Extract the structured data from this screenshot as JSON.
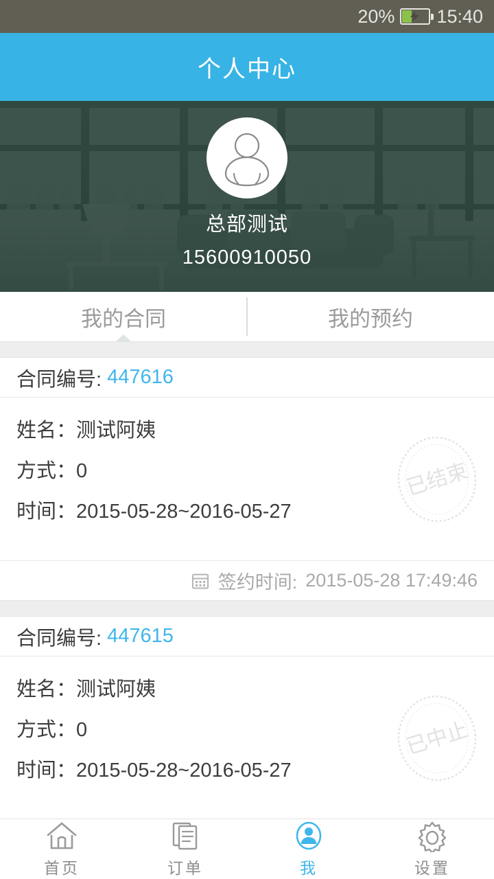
{
  "status_bar": {
    "battery_percent": "20%",
    "battery_icon": "battery-charging-icon",
    "time": "15:40",
    "background_color": "#615f54",
    "battery_fill_color": "#8bc34a"
  },
  "header": {
    "title": "个人中心",
    "background_color": "#38b3e5"
  },
  "profile": {
    "avatar_icon": "user-avatar-icon",
    "name": "总部测试",
    "phone": "15600910050"
  },
  "tabs": {
    "items": [
      {
        "label": "我的合同",
        "active": true
      },
      {
        "label": "我的预约",
        "active": false
      }
    ]
  },
  "contracts": [
    {
      "number_label": "合同编号:",
      "number_value": "447616",
      "name_label": "姓名：",
      "name_value": "测试阿姨",
      "method_label": "方式：",
      "method_value": "0",
      "time_label": "时间：",
      "time_value": "2015-05-28~2016-05-27",
      "stamp_text": "已结束",
      "sign_icon": "calendar-icon",
      "sign_label": "签约时间:",
      "sign_value": "2015-05-28 17:49:46"
    },
    {
      "number_label": "合同编号:",
      "number_value": "447615",
      "name_label": "姓名：",
      "name_value": "测试阿姨",
      "method_label": "方式：",
      "method_value": "0",
      "time_label": "时间：",
      "time_value": "2015-05-28~2016-05-27",
      "stamp_text": "已中止"
    }
  ],
  "bottom_nav": {
    "items": [
      {
        "label": "首页",
        "icon": "home-icon",
        "active": false
      },
      {
        "label": "订单",
        "icon": "documents-icon",
        "active": false
      },
      {
        "label": "我",
        "icon": "person-circle-icon",
        "active": true
      },
      {
        "label": "设置",
        "icon": "gear-icon",
        "active": false
      }
    ],
    "active_color": "#3fb6ec",
    "inactive_color": "#8e8e8e"
  }
}
